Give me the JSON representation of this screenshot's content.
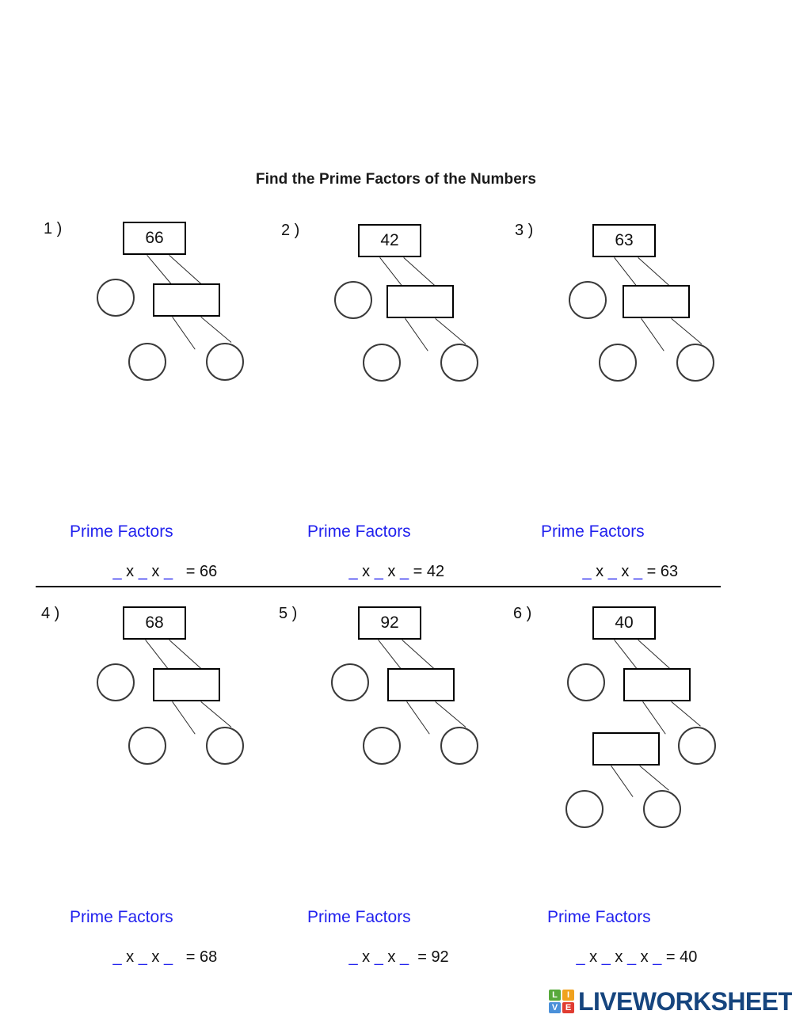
{
  "worksheet": {
    "title": "Find the Prime Factors of the Numbers"
  },
  "problems": [
    {
      "number": "1 )",
      "root_value": "66",
      "answer_title": "Prime Factors",
      "answer_line": "_ x _ x _   = 66",
      "answer_blanks": 3,
      "answer_result": "66",
      "tree_levels": 2
    },
    {
      "number": "2 )",
      "root_value": "42",
      "answer_title": "Prime Factors",
      "answer_line": "_ x _ x _ = 42",
      "answer_blanks": 3,
      "answer_result": "42",
      "tree_levels": 2
    },
    {
      "number": "3 )",
      "root_value": "63",
      "answer_title": "Prime Factors",
      "answer_line": "_ x _ x _ = 63",
      "answer_blanks": 3,
      "answer_result": "63",
      "tree_levels": 2
    },
    {
      "number": "4 )",
      "root_value": "68",
      "answer_title": "Prime Factors",
      "answer_line": "_ x _ x _  = 68",
      "answer_blanks": 3,
      "answer_result": "68",
      "tree_levels": 2
    },
    {
      "number": "5 )",
      "root_value": "92",
      "answer_title": "Prime Factors",
      "answer_line": "_ x _ x _  = 92",
      "answer_blanks": 3,
      "answer_result": "92",
      "tree_levels": 2
    },
    {
      "number": "6 )",
      "root_value": "40",
      "answer_title": "Prime Factors",
      "answer_line": "_ x _ x _ x _ = 40",
      "answer_blanks": 4,
      "answer_result": "40",
      "tree_levels": 3
    }
  ],
  "footer": {
    "logo_cells": [
      "L",
      "I",
      "V",
      "E"
    ],
    "logo_text": "LIVEWORKSHEETS",
    "logo_colors": {
      "L": "#57a93b",
      "I": "#f0a21e",
      "V": "#4a90d9",
      "E": "#e03c31",
      "word": "#16457e"
    }
  },
  "colors": {
    "blank_blue": "#2222ee",
    "ink": "#111111",
    "stroke": "#000000"
  }
}
